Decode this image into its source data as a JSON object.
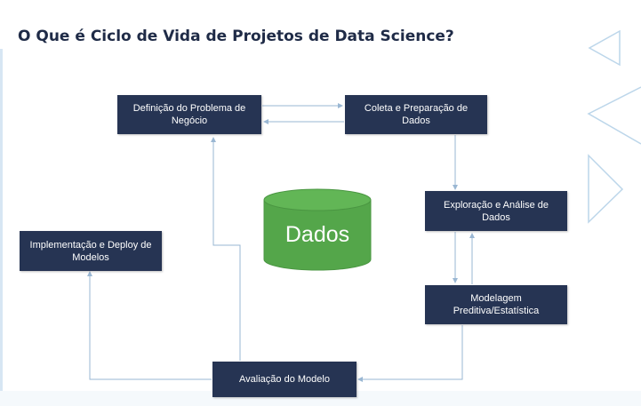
{
  "title": "O Que é Ciclo de Vida de Projetos de Data Science?",
  "diagram": {
    "database_label": "Dados",
    "nodes": {
      "definicao": "Definição do Problema de Negócio",
      "coleta": "Coleta e Preparação de Dados",
      "exploracao": "Exploração e Análise de Dados",
      "modelagem": "Modelagem Preditiva/Estatística",
      "avaliacao": "Avaliação do Modelo",
      "implementacao": "Implementação e Deploy de Modelos"
    }
  },
  "colors": {
    "node_fill": "#263453",
    "node_text": "#ffffff",
    "connector": "#9ab7d3",
    "database_fill": "#54a64a",
    "database_top": "#62b656",
    "title": "#1f2b47",
    "decor": "#bcd6ea"
  }
}
